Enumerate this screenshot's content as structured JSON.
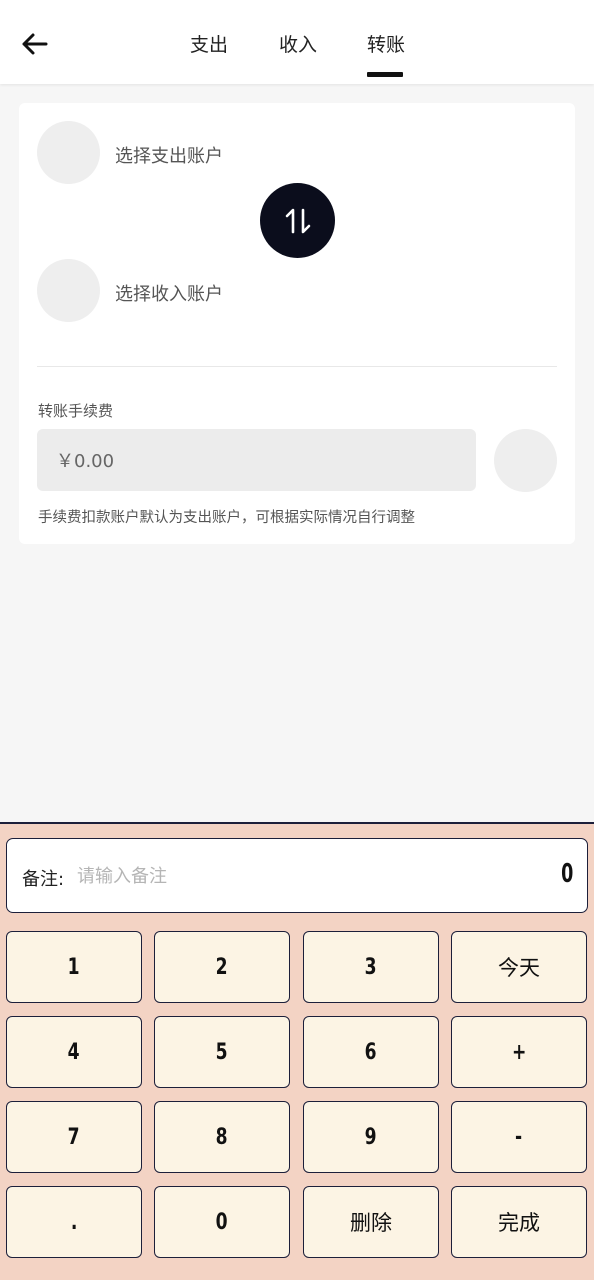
{
  "header": {
    "tabs": [
      {
        "label": "支出"
      },
      {
        "label": "收入"
      },
      {
        "label": "转账"
      }
    ],
    "active_tab": "转账"
  },
  "transfer": {
    "from_account_placeholder": "选择支出账户",
    "to_account_placeholder": "选择收入账户",
    "fee_label": "转账手续费",
    "fee_value": "￥0.00",
    "fee_hint": "手续费扣款账户默认为支出账户，可根据实际情况自行调整"
  },
  "keypad": {
    "note_label": "备注:",
    "note_placeholder": "请输入备注",
    "amount": "0",
    "keys": [
      "1",
      "2",
      "3",
      "今天",
      "4",
      "5",
      "6",
      "+",
      "7",
      "8",
      "9",
      "-",
      ".",
      "0",
      "删除",
      "完成"
    ]
  },
  "colors": {
    "accent": "#0b0d1c",
    "keypad_bg": "#f3d3c4",
    "key_bg": "#fcf4e4",
    "page_bg": "#f6f6f6"
  },
  "icons": {
    "back": "arrow-left-icon",
    "swap": "swap-vertical-icon"
  }
}
